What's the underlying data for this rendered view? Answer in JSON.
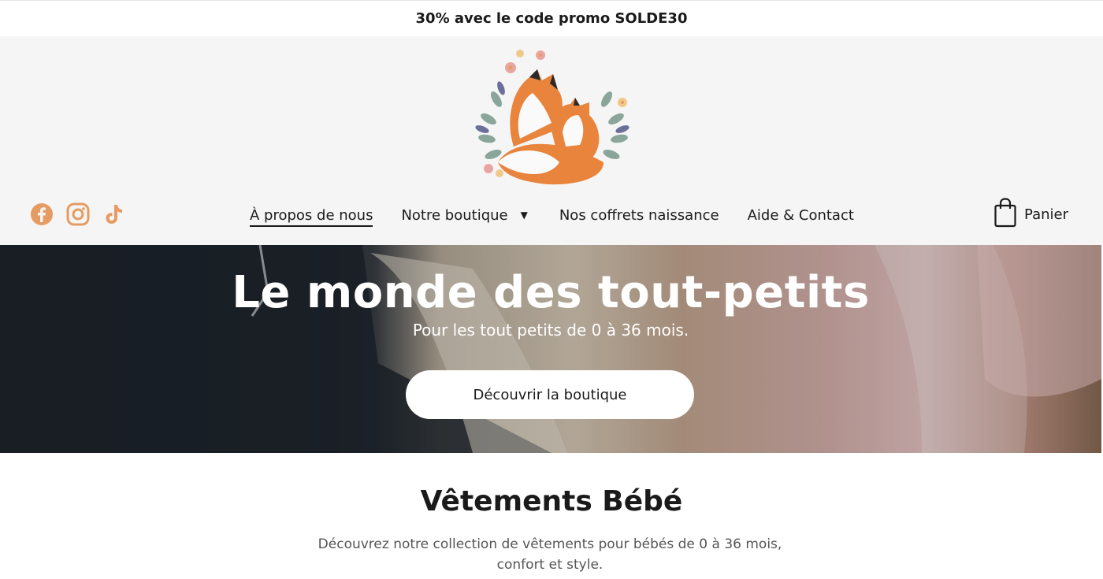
{
  "promo": {
    "text": "30% avec le code promo SOLDE30"
  },
  "social": {
    "icons": [
      "facebook-icon",
      "instagram-icon",
      "tiktok-icon"
    ],
    "color": "#e69b62"
  },
  "nav": {
    "items": [
      {
        "label": "À propos de nous"
      },
      {
        "label": "Notre boutique"
      },
      {
        "label": "Nos coffrets naissance"
      },
      {
        "label": "Aide & Contact"
      }
    ]
  },
  "cart": {
    "label": "Panier"
  },
  "hero": {
    "title": "Le monde des tout-petits",
    "subtitle": "Pour les tout petits de 0 à 36 mois.",
    "button": "Découvrir la boutique"
  },
  "section": {
    "title": "Vêtements Bébé",
    "description": "Découvrez notre collection de vêtements pour bébés de 0 à 36 mois, confort et style."
  },
  "colors": {
    "accent": "#e69b62",
    "header_bg": "#f5f5f5",
    "fox": "#e8843c"
  }
}
